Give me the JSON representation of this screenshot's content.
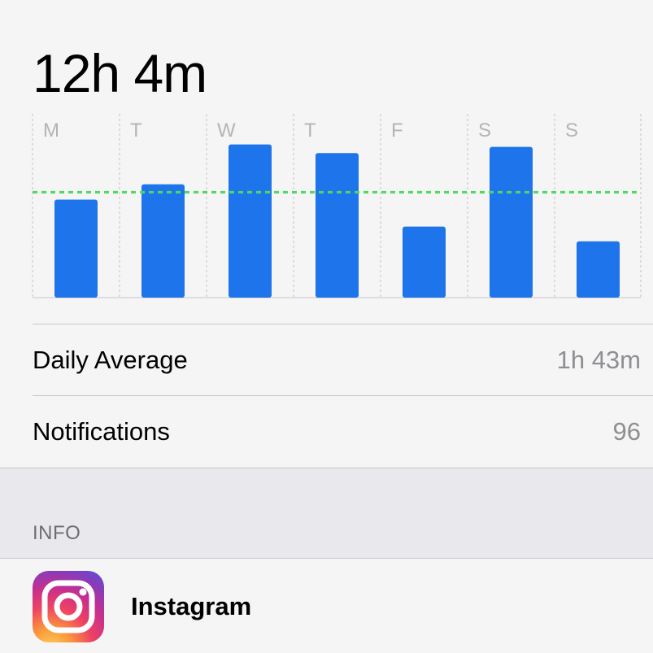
{
  "usage": {
    "total": "12h 4m"
  },
  "chart_data": {
    "type": "bar",
    "categories": [
      "M",
      "T",
      "W",
      "T",
      "F",
      "S",
      "S"
    ],
    "values": [
      1.6,
      1.85,
      2.5,
      2.36,
      1.16,
      2.46,
      0.92
    ],
    "average": 1.72,
    "ylim": [
      0,
      3.0
    ],
    "colors": {
      "bar": "#1e74eb",
      "average_line": "#4cd964",
      "gridline": "#c4c4c4",
      "day_label": "#b4b4b8"
    }
  },
  "stats": {
    "daily_average_label": "Daily Average",
    "daily_average_value": "1h 43m",
    "notifications_label": "Notifications",
    "notifications_value": "96"
  },
  "info_section": {
    "title": "INFO"
  },
  "app": {
    "name": "Instagram",
    "icon": "instagram-icon"
  }
}
